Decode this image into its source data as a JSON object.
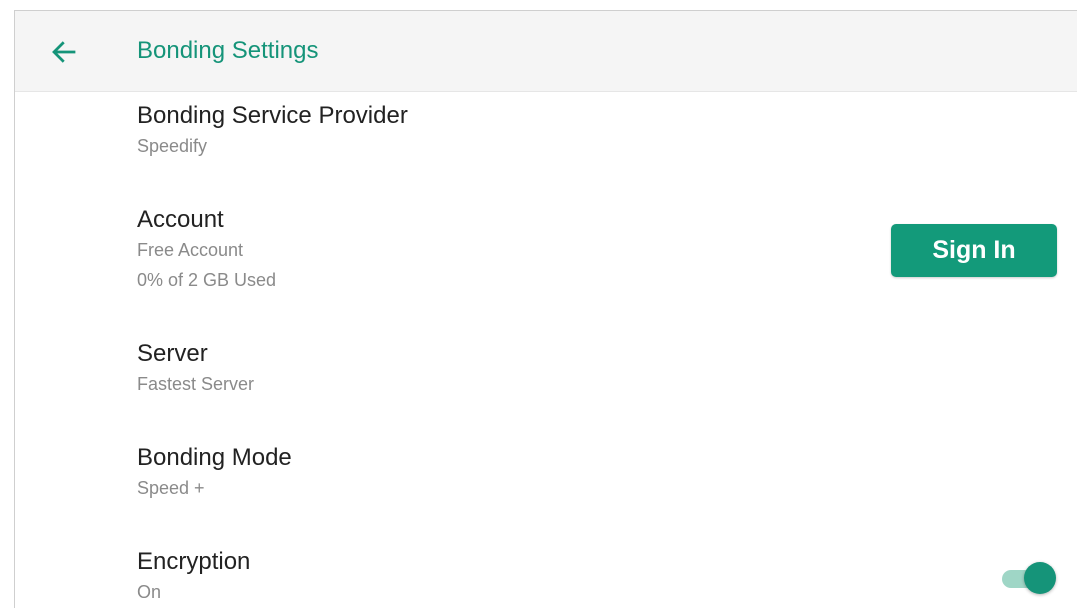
{
  "header": {
    "title": "Bonding Settings",
    "back_icon": "arrow-left-icon",
    "accent_color": "#159479"
  },
  "settings": {
    "provider": {
      "title": "Bonding Service Provider",
      "value": "Speedify"
    },
    "account": {
      "title": "Account",
      "plan": "Free Account",
      "usage": "0% of 2 GB Used",
      "sign_in_label": "Sign In"
    },
    "server": {
      "title": "Server",
      "value": "Fastest Server"
    },
    "mode": {
      "title": "Bonding Mode",
      "value": "Speed +"
    },
    "encryption": {
      "title": "Encryption",
      "value": "On",
      "enabled": true
    }
  }
}
